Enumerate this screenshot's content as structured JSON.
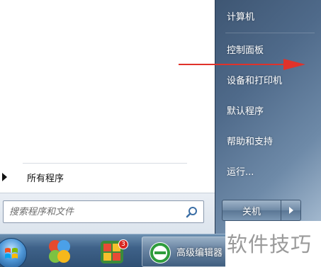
{
  "start_menu": {
    "all_programs_label": "所有程序",
    "search_placeholder": "搜索程序和文件",
    "right_items": [
      {
        "label": "计算机"
      },
      {
        "label": "控制面板"
      },
      {
        "label": "设备和打印机"
      },
      {
        "label": "默认程序"
      },
      {
        "label": "帮助和支持"
      },
      {
        "label": "运行..."
      }
    ],
    "shutdown_label": "关机"
  },
  "taskbar": {
    "active_window_label": "高级编辑器",
    "badge_count": "3"
  },
  "watermark": "软件技巧",
  "colors": {
    "annotation_arrow": "#e0322a",
    "right_pane": "#4f6a8a",
    "taskbar": "#3f6289"
  },
  "icons": [
    "windows-start-orb",
    "puzzle-app-icon",
    "game-grid-icon",
    "edge-like-browser-icon",
    "search-icon",
    "shutdown-arrow-icon"
  ]
}
